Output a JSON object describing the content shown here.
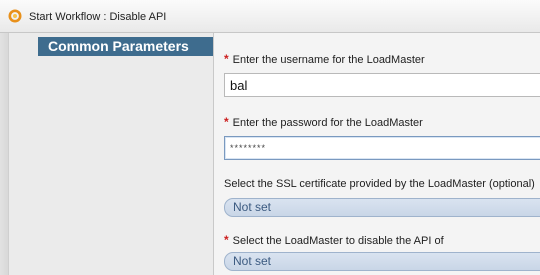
{
  "window": {
    "title": "Start Workflow : Disable API",
    "icon": "workflow-icon"
  },
  "sidebar": {
    "section_title": "Common Parameters"
  },
  "form": {
    "username": {
      "label": "Enter the username for the LoadMaster",
      "required": true,
      "value": "bal"
    },
    "password": {
      "label": "Enter the password for the LoadMaster",
      "required": true,
      "value": "********"
    },
    "ssl_cert": {
      "label": "Select the SSL certificate provided by the LoadMaster (optional)",
      "required": false,
      "value": "Not set"
    },
    "loadmaster": {
      "label": "Select the LoadMaster to disable the API of",
      "required": true,
      "value": "Not set"
    },
    "required_marker": "*"
  },
  "colors": {
    "section_header_bg": "#3e6c8e",
    "required_marker": "#cc1f1f",
    "select_text": "#3b5a80"
  }
}
